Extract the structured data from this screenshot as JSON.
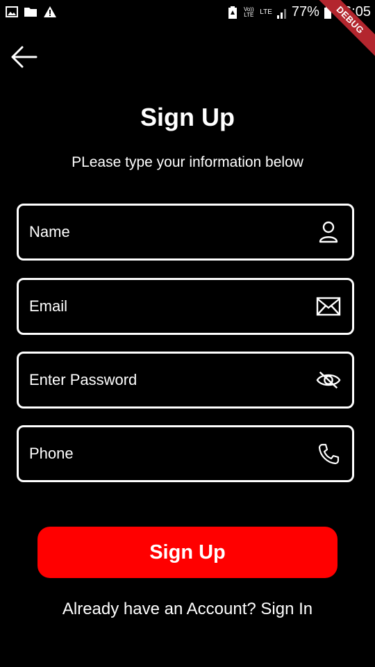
{
  "status_bar": {
    "battery": "77%",
    "time": "16:05",
    "volte_label": "Vo)) LTE",
    "lte_label": "LTE",
    "icons": [
      "image-icon",
      "folder-icon",
      "warning-icon",
      "battery-saver-icon",
      "signal-icon",
      "battery-icon"
    ]
  },
  "debug_banner": "DEBUG",
  "header": {
    "title": "Sign Up",
    "subtitle": "PLease type your information below"
  },
  "form": {
    "name_placeholder": "Name",
    "email_placeholder": "Email",
    "password_placeholder": "Enter Password",
    "phone_placeholder": "Phone"
  },
  "actions": {
    "signup_label": "Sign Up",
    "signin_text": "Already have an Account? Sign In"
  },
  "colors": {
    "background": "#000000",
    "primary_button": "#ff0000",
    "text": "#ffffff",
    "debug_banner": "#b3262e"
  }
}
